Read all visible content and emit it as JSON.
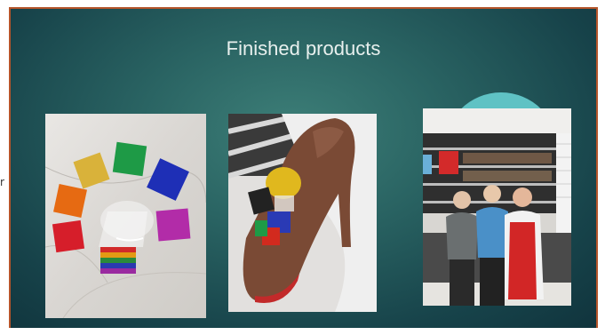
{
  "slide": {
    "title": "Finished products"
  },
  "images": [
    {
      "name": "photo-wrapped-chocolates",
      "alt": "Colorful foil-wrapped chocolate squares arranged in an arc"
    },
    {
      "name": "photo-chocolate-shoe",
      "alt": "Chocolate high-heel shoe filled with foil-wrapped candies"
    },
    {
      "name": "photo-shop-staff",
      "alt": "Three people standing in a chocolate shop"
    }
  ],
  "colors": {
    "frame": "#b5542a",
    "background": "#2a6463",
    "accent_circle": "#5fc2c4",
    "title_text": "#e8f0ee"
  }
}
